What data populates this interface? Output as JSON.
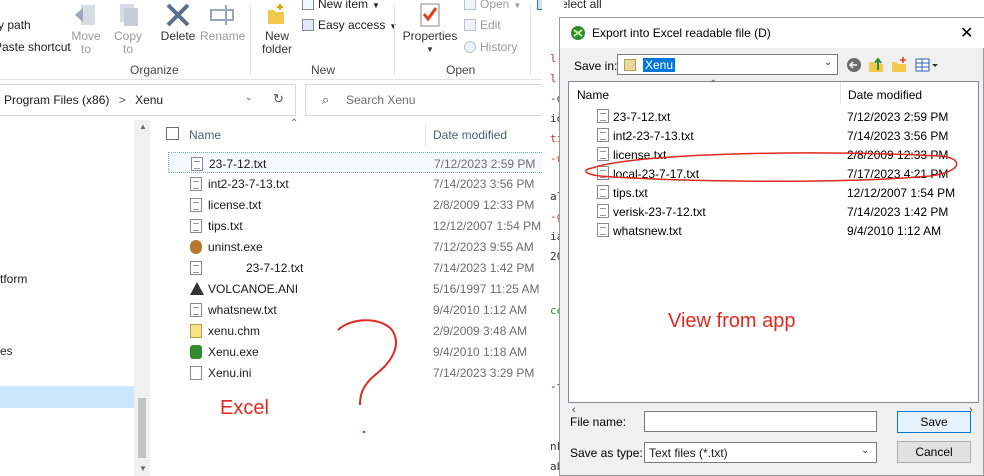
{
  "ribbon": {
    "path_label": "Copy path",
    "paste_shortcut_label": "Paste shortcut",
    "move_to": "Move\nto",
    "copy_to": "Copy\nto",
    "delete": "Delete",
    "rename": "Rename",
    "new_folder": "New\nfolder",
    "new_item": "New item",
    "easy_access": "Easy access",
    "properties": "Properties",
    "open": "Open",
    "edit": "Edit",
    "history": "History",
    "select_all": "Select all",
    "groups": {
      "organize": "Organize",
      "new": "New",
      "open": "Open"
    }
  },
  "address": {
    "crumbs": [
      "Program Files (x86)",
      "Xenu"
    ],
    "separator": ">",
    "search_placeholder": "Search Xenu"
  },
  "nav": {
    "items": [
      "tform",
      "es"
    ]
  },
  "filelist": {
    "columns": {
      "name": "Name",
      "date": "Date modified"
    },
    "files": [
      {
        "name": "23-7-12.txt",
        "date": "7/12/2023 2:59 PM",
        "icon": "text-file-icon"
      },
      {
        "name": "int2-23-7-13.txt",
        "date": "7/14/2023 3:56 PM",
        "icon": "text-file-icon"
      },
      {
        "name": "license.txt",
        "date": "2/8/2009 12:33 PM",
        "icon": "text-file-icon"
      },
      {
        "name": "tips.txt",
        "date": "12/12/2007 1:54 PM",
        "icon": "text-file-icon"
      },
      {
        "name": "uninst.exe",
        "date": "7/12/2023 9:55 AM",
        "icon": "installer-icon"
      },
      {
        "name": "23-7-12.txt",
        "date": "7/14/2023 1:42 PM",
        "icon": "text-file-icon"
      },
      {
        "name": "VOLCANOE.ANI",
        "date": "5/16/1997 11:25 AM",
        "icon": "cursor-file-icon"
      },
      {
        "name": "whatsnew.txt",
        "date": "9/4/2010 1:12 AM",
        "icon": "text-file-icon"
      },
      {
        "name": "xenu.chm",
        "date": "2/9/2009 3:48 AM",
        "icon": "help-file-icon"
      },
      {
        "name": "Xenu.exe",
        "date": "9/4/2010 1:18 AM",
        "icon": "xenu-app-icon"
      },
      {
        "name": "Xenu.ini",
        "date": "7/14/2023 3:29 PM",
        "icon": "settings-file-icon"
      }
    ]
  },
  "strip": {
    "lines": [
      "l-c",
      "l-c",
      "-q",
      "idt",
      "tic",
      "-u",
      "als",
      "-g",
      "ia",
      "20",
      "ce",
      "-t",
      "nk",
      "ab"
    ]
  },
  "dialog": {
    "title": "Export into Excel readable file (D)",
    "save_in_label": "Save in:",
    "save_in_value": "Xenu",
    "columns": {
      "name": "Name",
      "date": "Date modified"
    },
    "files": [
      {
        "name": "23-7-12.txt",
        "date": "7/12/2023 2:59 PM"
      },
      {
        "name": "int2-23-7-13.txt",
        "date": "7/14/2023 3:56 PM"
      },
      {
        "name": "license.txt",
        "date": "2/8/2009 12:33 PM"
      },
      {
        "name": "local-23-7-17.txt",
        "date": "7/17/2023 4:21 PM"
      },
      {
        "name": "tips.txt",
        "date": "12/12/2007 1:54 PM"
      },
      {
        "name": "verisk-23-7-12.txt",
        "date": "7/14/2023 1:42 PM"
      },
      {
        "name": "whatsnew.txt",
        "date": "9/4/2010 1:12 AM"
      }
    ],
    "file_name_label": "File name:",
    "file_name_value": "",
    "save_as_type_label": "Save as type:",
    "save_as_type_value": "Text files (*.txt)",
    "save_button": "Save",
    "cancel_button": "Cancel"
  },
  "annotations": {
    "excel": "Excel",
    "view_from_app": "View from app",
    "color": "#e0281f"
  }
}
